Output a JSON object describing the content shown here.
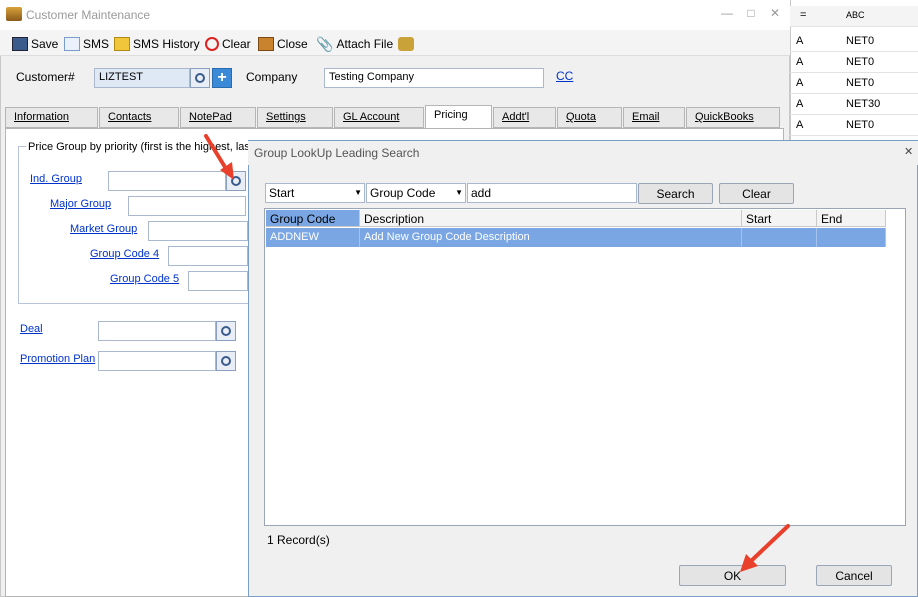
{
  "window": {
    "title": "Customer Maintenance"
  },
  "toolbar": {
    "save": "Save",
    "sms": "SMS",
    "sms_history": "SMS History",
    "clear": "Clear",
    "close": "Close",
    "attach_file": "Attach File"
  },
  "header": {
    "customer_label": "Customer#",
    "customer_value": "LIZTEST",
    "company_label": "Company",
    "company_value": "Testing Company",
    "cc_link": "CC"
  },
  "tabs": [
    "Information",
    "Contacts",
    "NotePad",
    "Settings",
    "GL Account",
    "Pricing",
    "Addt'l",
    "Quota",
    "Email",
    "QuickBooks"
  ],
  "pricing": {
    "group_legend": "Price Group by priority (first is the highest, las",
    "ind_group": "Ind. Group",
    "major_group": "Major Group",
    "market_group": "Market Group",
    "group_code_4": "Group Code 4",
    "group_code_5": "Group Code 5",
    "deal": "Deal",
    "promotion_plan": "Promotion Plan"
  },
  "bg_grid": {
    "header": [
      "=",
      "ABC"
    ],
    "rows": [
      [
        "A",
        "NET0"
      ],
      [
        "A",
        "NET0"
      ],
      [
        "A",
        "NET0"
      ],
      [
        "A",
        "NET30"
      ],
      [
        "A",
        "NET0"
      ]
    ]
  },
  "dialog": {
    "title": "Group LookUp  Leading Search",
    "match_mode": "Start",
    "search_field": "Group Code",
    "search_text": "add",
    "search_button": "Search",
    "clear_button": "Clear",
    "columns": [
      "Group Code",
      "Description",
      "Start",
      "End"
    ],
    "rows": [
      {
        "group_code": "ADDNEW",
        "description": "Add New Group Code Description",
        "start": "",
        "end": ""
      }
    ],
    "record_count": "1 Record(s)",
    "ok_button": "OK",
    "cancel_button": "Cancel"
  },
  "colors": {
    "accent": "#0033cc",
    "selection": "#7aa6e4",
    "annotation": "#e8402a"
  }
}
